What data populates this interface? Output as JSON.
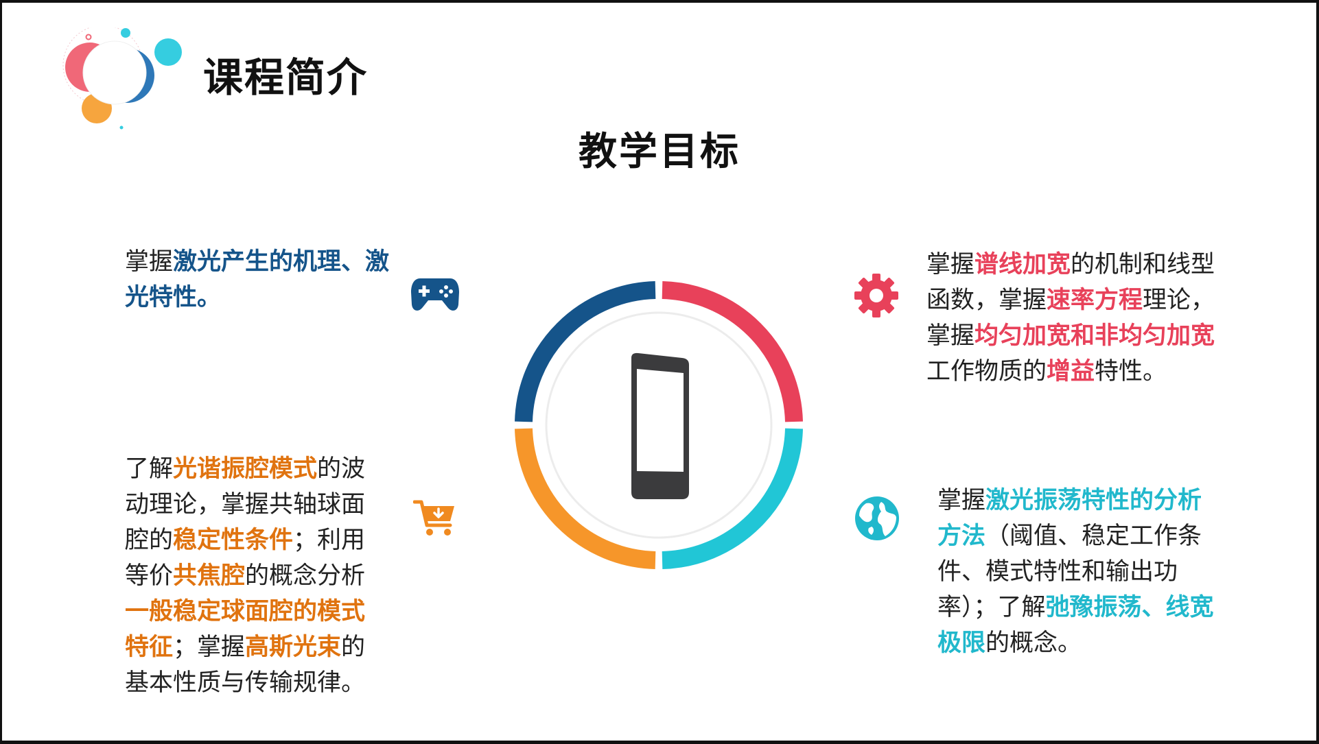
{
  "header": {
    "title": "课程简介"
  },
  "section": {
    "title": "教学目标"
  },
  "colors": {
    "blue": "#15548a",
    "red": "#e8415a",
    "orange": "#e0730f",
    "teal": "#21b8cc"
  },
  "icons": {
    "top_left": "gamepad-icon",
    "top_right": "gear-icon",
    "bottom_left": "shopping-cart-icon",
    "bottom_right": "globe-icon",
    "center": "smartphone-icon"
  },
  "goals": {
    "top_left": [
      "掌握",
      "激光产生的机理、激光特性。"
    ],
    "top_right": [
      "掌握",
      "谱线加宽",
      "的机制和线型函数，掌握",
      "速率方程",
      "理论，掌握",
      "均匀加宽和非均匀加宽",
      "工作物质的",
      "增益",
      "特性。"
    ],
    "bottom_left": [
      "了解",
      "光谐振腔模式",
      "的波动理论，掌握共轴球面腔的",
      "稳定性条件",
      "；利用等价",
      "共焦腔",
      "的概念分析",
      "一般稳定球面腔的模式特征",
      "；掌握",
      "高斯光束",
      "的基本性质与传输规律。"
    ],
    "bottom_right": [
      "掌握",
      "激光振荡特性的分析方法",
      "（阈值、稳定工作条件、模式特性和输出功率）；了解",
      "弛豫振荡、线宽极限",
      "的概念。"
    ]
  }
}
